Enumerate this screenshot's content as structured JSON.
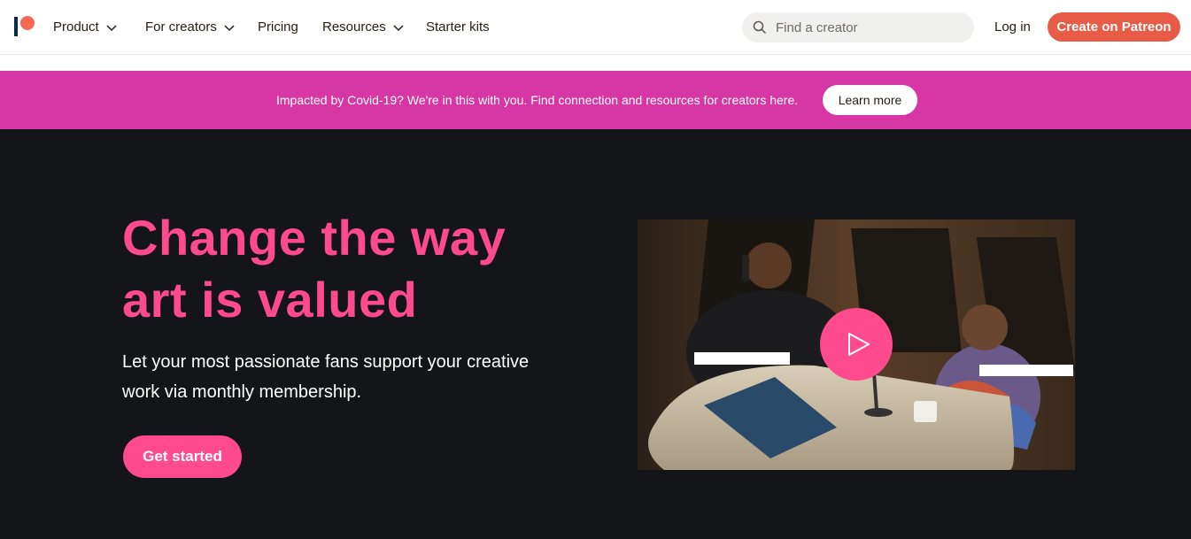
{
  "nav": {
    "logo": "patreon-logo",
    "items": [
      {
        "label": "Product",
        "has_dropdown": true
      },
      {
        "label": "For creators",
        "has_dropdown": true
      },
      {
        "label": "Pricing",
        "has_dropdown": false
      },
      {
        "label": "Resources",
        "has_dropdown": true
      },
      {
        "label": "Starter kits",
        "has_dropdown": false
      }
    ],
    "search_placeholder": "Find a creator",
    "login_label": "Log in",
    "create_label": "Create on Patreon"
  },
  "banner": {
    "text": "Impacted by Covid-19? We're in this with you. Find connection and resources for creators here.",
    "button_label": "Learn more",
    "color": "#d637a4"
  },
  "hero": {
    "headline_line1": "Change the way",
    "headline_line2": "art is valued",
    "subtext": "Let your most passionate fans support your creative work via monthly membership.",
    "cta_label": "Get started",
    "accent_color": "#ff4a8d",
    "background": "#141518"
  },
  "video": {
    "play_icon": "play-icon"
  },
  "colors": {
    "brand": "#f96854",
    "create_button": "#e85b46"
  }
}
